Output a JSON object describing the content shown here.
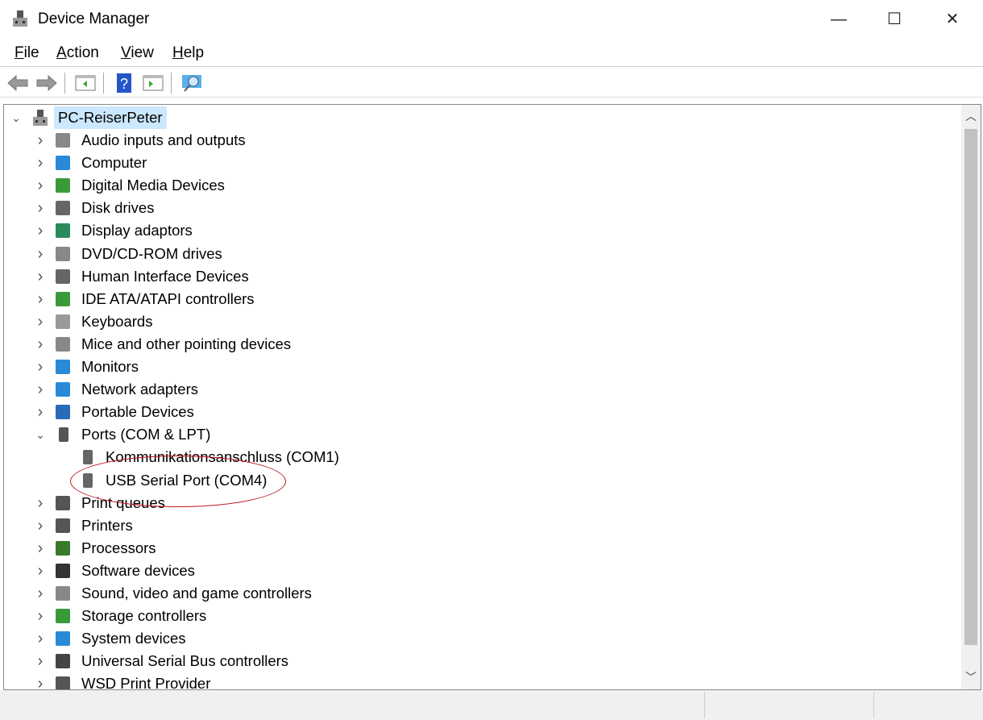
{
  "window": {
    "title": "Device Manager",
    "minimize": "—",
    "maximize": "☐",
    "close": "✕"
  },
  "menu": [
    {
      "key": "F",
      "rest": "ile"
    },
    {
      "key": "A",
      "rest": "ction"
    },
    {
      "key": "V",
      "rest": "iew"
    },
    {
      "key": "H",
      "rest": "elp"
    }
  ],
  "toolbar": [
    "back-icon",
    "forward-icon",
    "show-hide-console-tree-icon",
    "help-icon",
    "show-action-pane-icon",
    "scan-hardware-icon"
  ],
  "tree": {
    "root": "PC-ReiserPeter",
    "items": [
      {
        "label": "Audio inputs and outputs",
        "icon": "speaker-icon",
        "color": "#888"
      },
      {
        "label": "Computer",
        "icon": "computer-icon",
        "color": "#2a8ad8"
      },
      {
        "label": "Digital Media Devices",
        "icon": "media-device-icon",
        "color": "#3a9a3a"
      },
      {
        "label": "Disk drives",
        "icon": "disk-drive-icon",
        "color": "#666"
      },
      {
        "label": "Display adaptors",
        "icon": "display-adapter-icon",
        "color": "#2a8a5a"
      },
      {
        "label": "DVD/CD-ROM drives",
        "icon": "dvd-drive-icon",
        "color": "#888"
      },
      {
        "label": "Human Interface Devices",
        "icon": "hid-icon",
        "color": "#666"
      },
      {
        "label": "IDE ATA/ATAPI controllers",
        "icon": "ide-controller-icon",
        "color": "#3a9a3a"
      },
      {
        "label": "Keyboards",
        "icon": "keyboard-icon",
        "color": "#999"
      },
      {
        "label": "Mice and other pointing devices",
        "icon": "mouse-icon",
        "color": "#888"
      },
      {
        "label": "Monitors",
        "icon": "monitor-icon",
        "color": "#2a8ad8"
      },
      {
        "label": "Network adapters",
        "icon": "network-adapter-icon",
        "color": "#2a8ad8"
      },
      {
        "label": "Portable Devices",
        "icon": "portable-device-icon",
        "color": "#2a6ab8"
      },
      {
        "label": "Ports (COM & LPT)",
        "icon": "port-icon",
        "color": "#555",
        "expanded": true,
        "children": [
          {
            "label": "Kommunikationsanschluss (COM1)",
            "icon": "port-icon"
          },
          {
            "label": "USB Serial Port (COM4)",
            "icon": "port-icon",
            "highlighted": true
          }
        ]
      },
      {
        "label": "Print queues",
        "icon": "printer-icon",
        "color": "#555"
      },
      {
        "label": "Printers",
        "icon": "printer-icon",
        "color": "#555"
      },
      {
        "label": "Processors",
        "icon": "processor-icon",
        "color": "#3a7a2a"
      },
      {
        "label": "Software devices",
        "icon": "software-device-icon",
        "color": "#333"
      },
      {
        "label": "Sound, video and game controllers",
        "icon": "speaker-icon",
        "color": "#888"
      },
      {
        "label": "Storage controllers",
        "icon": "storage-controller-icon",
        "color": "#3a9a3a"
      },
      {
        "label": "System devices",
        "icon": "system-device-icon",
        "color": "#2a8ad8"
      },
      {
        "label": "Universal Serial Bus controllers",
        "icon": "usb-icon",
        "color": "#444"
      },
      {
        "label": "WSD Print Provider",
        "icon": "printer-icon",
        "color": "#555"
      }
    ]
  },
  "colors": {
    "selection": "#cce8ff",
    "annotation": "#c0141c"
  }
}
